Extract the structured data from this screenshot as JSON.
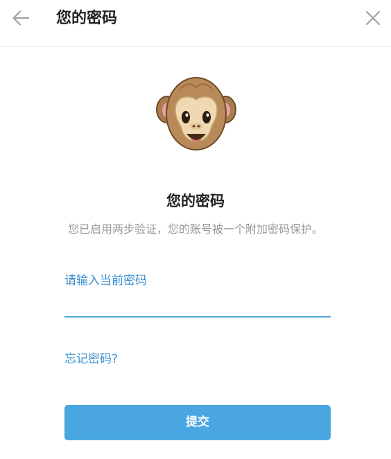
{
  "header": {
    "title": "您的密码",
    "back_icon": "arrow-left-icon",
    "close_icon": "close-icon"
  },
  "illustration": {
    "icon": "monkey-face-icon"
  },
  "main": {
    "title": "您的密码",
    "subtitle": "您已启用两步验证，您的账号被一个附加密码保护。",
    "field_label": "请输入当前密码",
    "password_value": "",
    "forgot_link": "忘记密码?",
    "submit_label": "提交"
  },
  "colors": {
    "accent": "#3a8fd0",
    "button": "#4aa6e0",
    "input_underline": "#52a5dc",
    "title_text": "#222222",
    "subtitle_text": "#999999"
  }
}
